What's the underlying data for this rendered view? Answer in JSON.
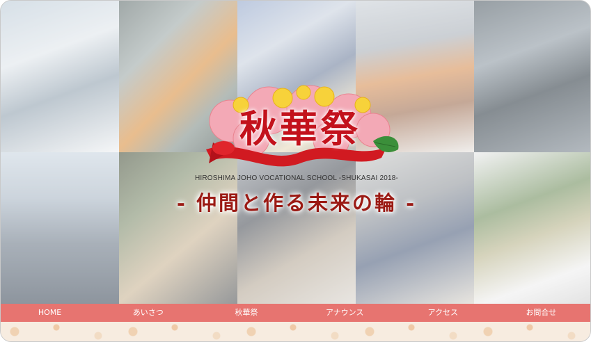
{
  "page": {
    "title": "秋華祭",
    "subtitle_en": "HIROSHIMA JOHO VOCATIONAL SCHOOL -SHUKASAI 2018-",
    "tagline": "- 仲間と作る未来の輪 -"
  },
  "nav": {
    "items": [
      {
        "label": "HOME"
      },
      {
        "label": "あいさつ"
      },
      {
        "label": "秋華祭"
      },
      {
        "label": "アナウンス"
      },
      {
        "label": "アクセス"
      },
      {
        "label": "お問合せ"
      }
    ]
  },
  "colors": {
    "nav_bg": "#e77470",
    "title_red": "#c3121c",
    "tagline_red": "#9b1a14"
  },
  "icons": {
    "logo": "flower-ribbon-logo"
  }
}
